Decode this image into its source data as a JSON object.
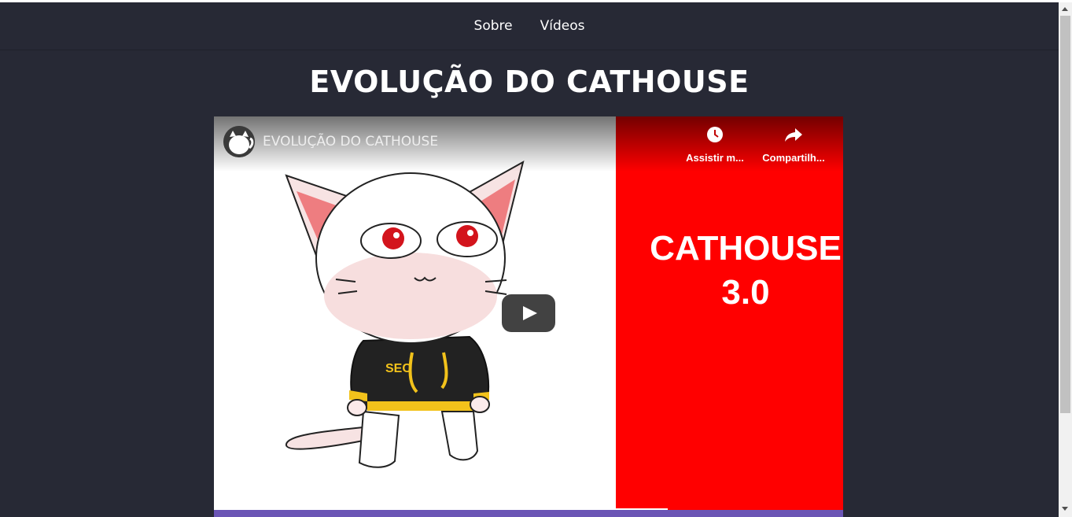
{
  "nav": {
    "items": [
      {
        "label": "Sobre"
      },
      {
        "label": "Vídeos"
      }
    ]
  },
  "page": {
    "title": "EVOLUÇÃO DO CATHOUSE"
  },
  "video": {
    "title": "EVOLUÇÃO DO CATHOUSE",
    "watch_later_label": "Assistir m...",
    "share_label": "Compartilh...",
    "thumbnail_text_line1": "CATHOUSE",
    "thumbnail_text_line2": "3.0",
    "hoodie_text": "SEC",
    "accent_color": "#ff0000",
    "icons": [
      "clock-icon",
      "share-icon",
      "play-icon"
    ]
  }
}
